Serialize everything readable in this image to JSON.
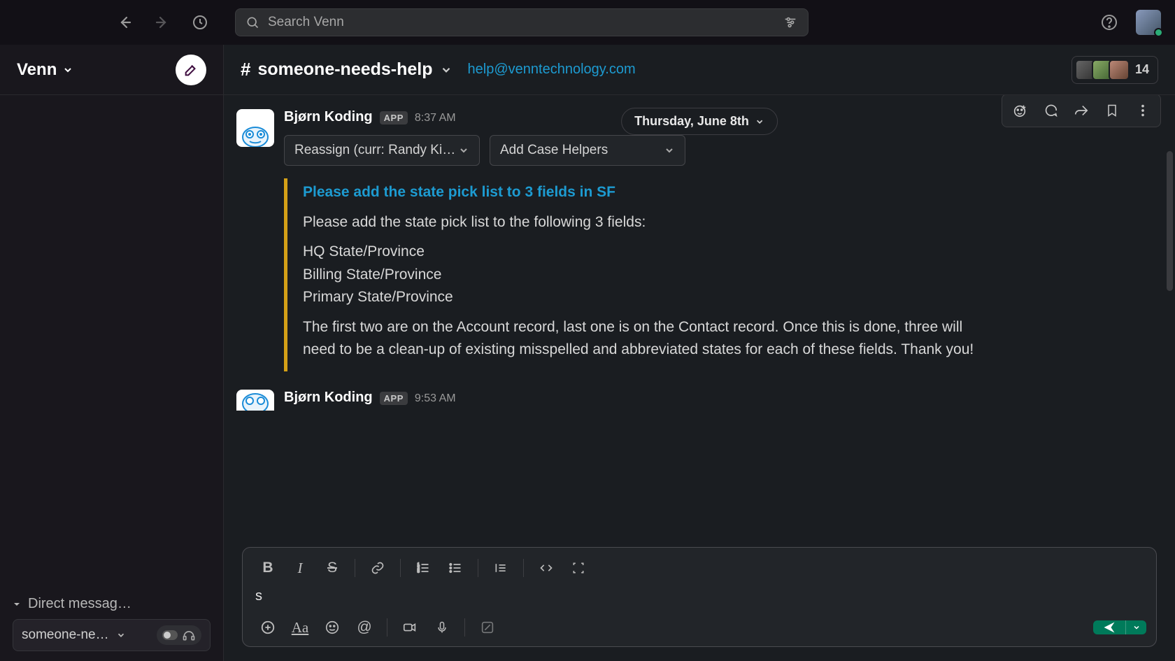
{
  "search": {
    "placeholder": "Search Venn"
  },
  "workspace": {
    "name": "Venn"
  },
  "sidebar": {
    "dm_header": "Direct messag…",
    "dm_item": "someone-ne…"
  },
  "channel": {
    "name": "someone-needs-help",
    "topic": "help@venntechnology.com",
    "member_count": "14"
  },
  "date_divider": "Thursday, June 8th",
  "messages": [
    {
      "author": "Bjørn Koding",
      "badge": "APP",
      "time": "8:37 AM",
      "selects": {
        "reassign": "Reassign (curr: Randy Ki…",
        "add_helpers": "Add Case Helpers"
      },
      "quote": {
        "title": "Please add the state pick list to 3 fields in SF",
        "intro": "Please add the state pick list to the following 3 fields:",
        "fields": [
          "HQ State/Province",
          "Billing State/Province",
          "Primary State/Province"
        ],
        "note": "The first two are on the Account record, last one is on the Contact record.  Once this is done, three will need to be a clean-up of existing misspelled and abbreviated states for each of these fields.  Thank you!"
      }
    },
    {
      "author": "Bjørn Koding",
      "badge": "APP",
      "time": "9:53 AM"
    }
  ],
  "composer": {
    "value": "s"
  }
}
